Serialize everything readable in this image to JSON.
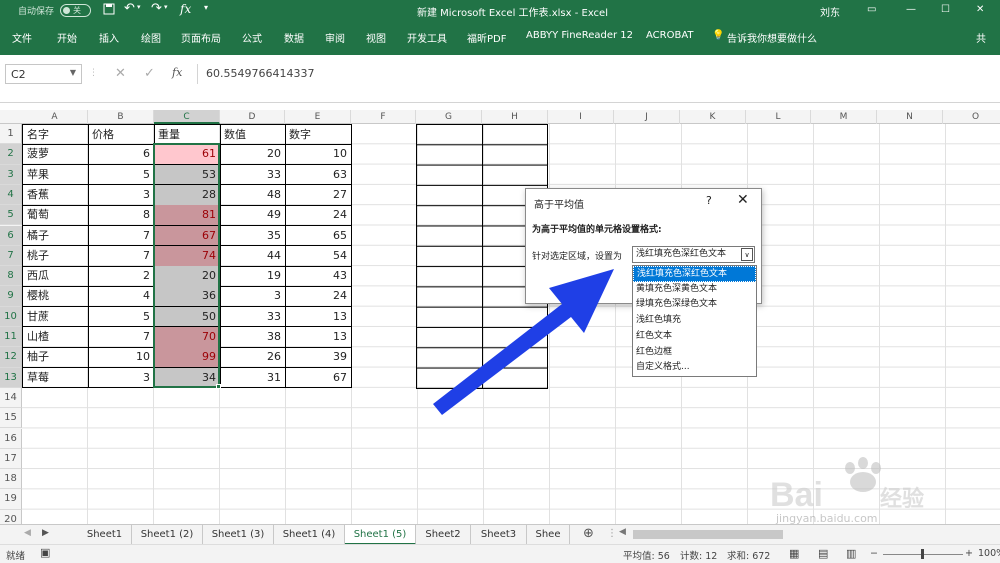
{
  "titlebar": {
    "autosave_label": "自动保存",
    "autosave_state": "关",
    "title": "新建 Microsoft Excel 工作表.xlsx  -  Excel",
    "user": "刘东",
    "icons": [
      "save-icon",
      "undo-icon",
      "redo-icon",
      "function-icon",
      "customize-qat-icon"
    ]
  },
  "ribbon": {
    "tabs": [
      "文件",
      "开始",
      "插入",
      "绘图",
      "页面布局",
      "公式",
      "数据",
      "审阅",
      "视图",
      "开发工具",
      "福昕PDF",
      "ABBYY FineReader 12",
      "ACROBAT"
    ],
    "tell_me": "告诉我你想要做什么",
    "share": "共"
  },
  "formula_bar": {
    "name_box": "C2",
    "value": "60.5549766414337"
  },
  "columns": [
    "A",
    "B",
    "C",
    "D",
    "E",
    "F",
    "G",
    "H",
    "I",
    "J",
    "K",
    "L",
    "M",
    "N",
    "O"
  ],
  "rows": [
    "1",
    "2",
    "3",
    "4",
    "5",
    "6",
    "7",
    "8",
    "9",
    "10",
    "11",
    "12",
    "13",
    "14",
    "15",
    "16",
    "17",
    "18",
    "19",
    "20"
  ],
  "table": {
    "headers": [
      "名字",
      "价格",
      "重量",
      "数值",
      "数字"
    ],
    "rows": [
      [
        "菠萝",
        "6",
        "61",
        "20",
        "10"
      ],
      [
        "苹果",
        "5",
        "53",
        "33",
        "63"
      ],
      [
        "香蕉",
        "3",
        "28",
        "48",
        "27"
      ],
      [
        "葡萄",
        "8",
        "81",
        "49",
        "24"
      ],
      [
        "橘子",
        "7",
        "67",
        "35",
        "65"
      ],
      [
        "桃子",
        "7",
        "74",
        "44",
        "54"
      ],
      [
        "西瓜",
        "2",
        "20",
        "19",
        "43"
      ],
      [
        "樱桃",
        "4",
        "36",
        "3",
        "24"
      ],
      [
        "甘蔗",
        "5",
        "50",
        "33",
        "13"
      ],
      [
        "山楂",
        "7",
        "70",
        "38",
        "13"
      ],
      [
        "柚子",
        "10",
        "99",
        "26",
        "39"
      ],
      [
        "草莓",
        "3",
        "34",
        "31",
        "67"
      ]
    ],
    "highlighted": [
      true,
      false,
      false,
      true,
      true,
      true,
      false,
      false,
      false,
      true,
      true,
      false
    ]
  },
  "dialog": {
    "title": "高于平均值",
    "help": "?",
    "close": "✕",
    "description": "为高于平均值的单元格设置格式:",
    "label": "针对选定区域，设置为",
    "selected": "浅红填充色深红色文本",
    "options": [
      "浅红填充色深红色文本",
      "黄填充色深黄色文本",
      "绿填充色深绿色文本",
      "浅红色填充",
      "红色文本",
      "红色边框",
      "自定义格式..."
    ]
  },
  "sheets": [
    "Sheet1",
    "Sheet1 (2)",
    "Sheet1 (3)",
    "Sheet1 (4)",
    "Sheet1 (5)",
    "Sheet2",
    "Sheet3",
    "Shee"
  ],
  "active_sheet": "Sheet1 (5)",
  "status": {
    "mode": "就绪",
    "average": "平均值: 56",
    "count": "计数: 12",
    "sum": "求和: 672",
    "zoom": "100%"
  },
  "colors": {
    "accent": "#217346",
    "highlight_fill": "#ffc7ce",
    "highlight_text": "#9c0006",
    "selection_overlay": "#c6c6c6",
    "arrow": "#1f3fe6"
  },
  "watermark": {
    "text": "Bai 经验",
    "url": "jingyan.baidu.com"
  }
}
